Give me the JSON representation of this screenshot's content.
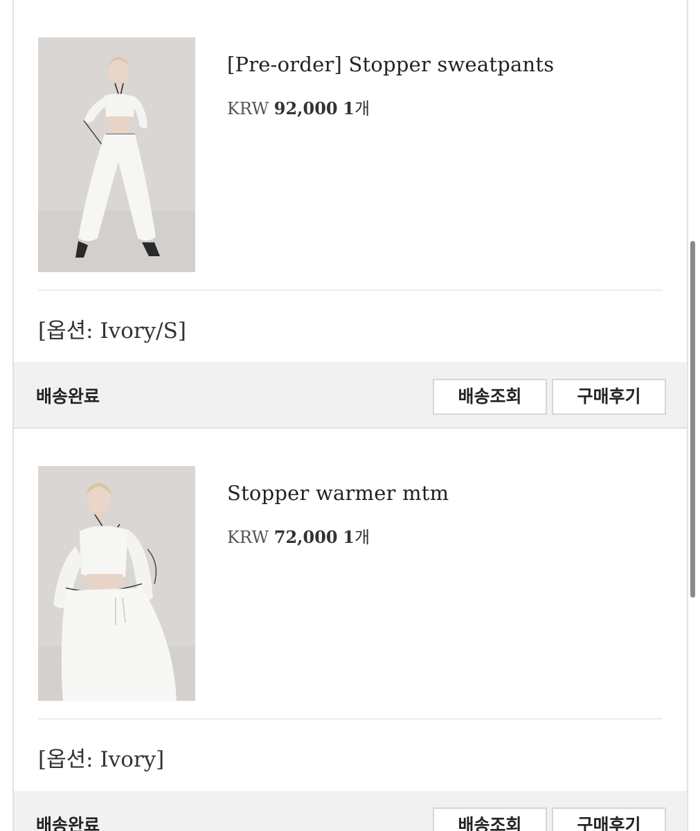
{
  "orders": [
    {
      "product_name": "[Pre-order] Stopper sweatpants",
      "currency": "KRW",
      "price": "92,000",
      "qty_number": "1",
      "qty_unit": "개",
      "option": "[옵션: Ivory/S]",
      "status": "배송완료",
      "track_button": "배송조회",
      "review_button": "구매후기"
    },
    {
      "product_name": "Stopper warmer mtm",
      "currency": "KRW",
      "price": "72,000",
      "qty_number": "1",
      "qty_unit": "개",
      "option": "[옵션: Ivory]",
      "status": "배송완료",
      "track_button": "배송조회",
      "review_button": "구매후기"
    }
  ],
  "colors": {
    "status_bar_bg": "#f1f1f1",
    "border": "#e2e2e2",
    "text": "#222222"
  }
}
